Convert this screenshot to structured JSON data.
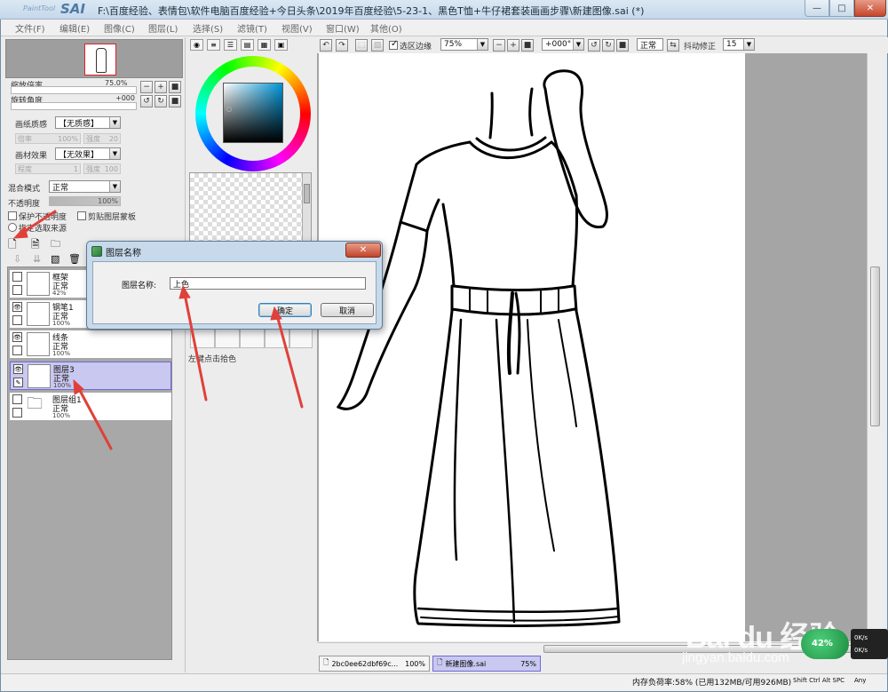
{
  "window": {
    "title": "F:\\百度经验、表情包\\软件电脑百度经验+今日头条\\2019年百度经验\\5-23-1、黑色T恤+牛仔裙套装画画步骤\\新建图像.sai (*)",
    "logo_prefix": "PaintTool",
    "logo_main": "SAI",
    "min_glyph": "—",
    "max_glyph": "□",
    "close_glyph": "✕"
  },
  "menu": [
    "文件(F)",
    "编辑(E)",
    "图像(C)",
    "图层(L)",
    "选择(S)",
    "滤镜(T)",
    "视图(V)",
    "窗口(W)",
    "其他(O)"
  ],
  "navigator": {
    "zoom_label": "缩放倍率",
    "zoom_value": "75.0%",
    "rotate_label": "旋转角度",
    "rotate_value": "+000"
  },
  "paper": {
    "texture_label": "画纸质感",
    "texture_value": "【无质感】",
    "scale_label": "倍率",
    "scale_value": "100%",
    "strength_label": "强度",
    "strength_value": "20",
    "effect_label": "画材效果",
    "effect_value": "【无效果】",
    "degree_label": "程度",
    "degree_value": "1",
    "effect_strength_label": "强度",
    "effect_strength_value": "100"
  },
  "layer_props": {
    "blend_label": "混合模式",
    "blend_value": "正常",
    "opacity_label": "不透明度",
    "opacity_value": "100%",
    "protect_alpha": "保护不透明度",
    "clip_mask": "剪贴图层蒙板",
    "pick_source": "指定选取来源"
  },
  "layers": [
    {
      "name": "框架",
      "mode": "正常",
      "opacity": "42%",
      "visible": false,
      "selected": false
    },
    {
      "name": "钢笔1",
      "mode": "正常",
      "opacity": "100%",
      "visible": true,
      "selected": false
    },
    {
      "name": "线条",
      "mode": "正常",
      "opacity": "100%",
      "visible": true,
      "selected": false
    },
    {
      "name": "图层3",
      "mode": "正常",
      "opacity": "100%",
      "visible": true,
      "selected": true
    },
    {
      "name": "图层组1",
      "mode": "正常",
      "opacity": "100%",
      "visible": false,
      "selected": false
    }
  ],
  "canvas_toolbar": {
    "selection_edge_label": "选区边缘",
    "zoom_value": "75%",
    "rotation_value": "+000°",
    "blend_value": "正常",
    "stabilizer_label": "抖动修正",
    "stabilizer_value": "15"
  },
  "tools": {
    "left_click_pick": "左键点击拾色"
  },
  "dialog": {
    "title": "图层名称",
    "field_label": "图层名称:",
    "field_value": "上色",
    "ok_label": "确定",
    "cancel_label": "取消"
  },
  "doc_tabs": [
    {
      "name": "2bc0ee62dbf69c...",
      "zoom": "100%",
      "active": false
    },
    {
      "name": "新建图像.sai",
      "zoom": "75%",
      "active": true
    }
  ],
  "status": {
    "memory": "内存负荷率:58% (已用132MB/可用926MB)",
    "keys": "Shift Ctrl Alt SPC",
    "any": "Any"
  },
  "overlay": {
    "watermark": "Bai du 经验",
    "watermark_url": "jingyan.baidu.com",
    "perf_value": "42%",
    "net_up": "0K/s",
    "net_down": "0K/s"
  },
  "colors": {
    "selection_highlight": "#c9c8f0",
    "dialog_frame": "#c7daec",
    "annotation_arrow": "#e0403a"
  }
}
